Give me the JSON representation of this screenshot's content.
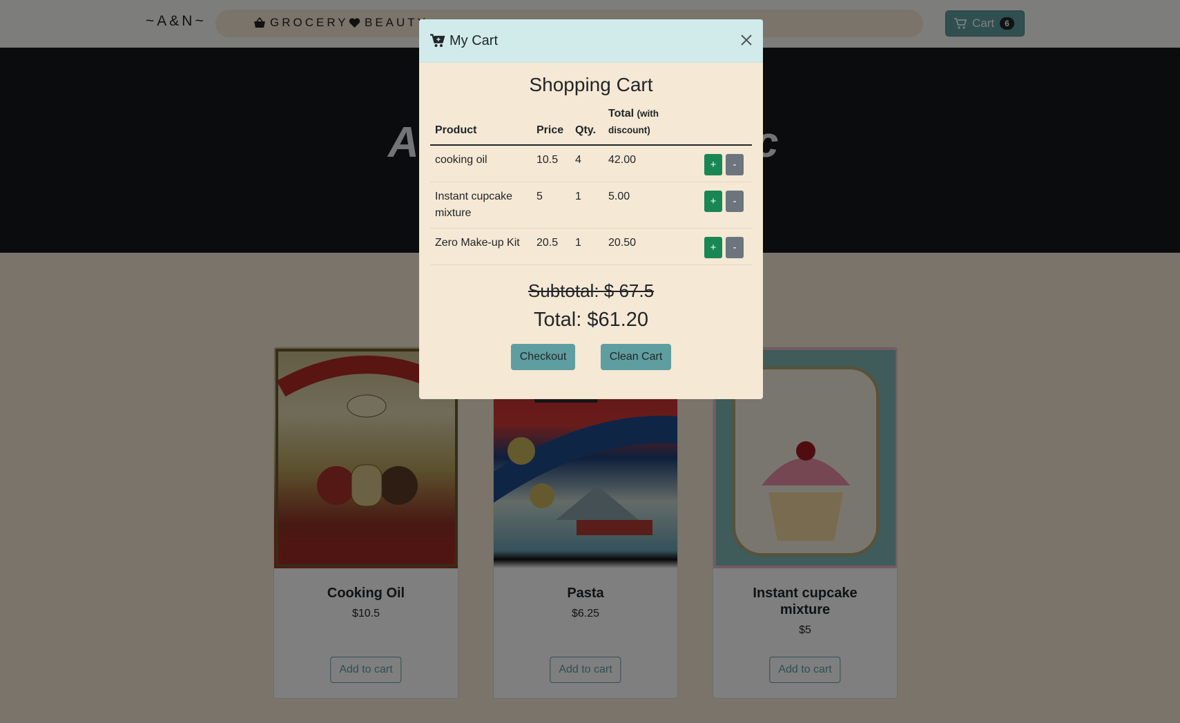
{
  "navbar": {
    "brand": "~A&N~",
    "links": [
      {
        "label": "GROCERY",
        "icon": "basket-icon"
      },
      {
        "label": "BEAUTY",
        "icon": "heart-icon"
      }
    ],
    "cart": {
      "label": "Cart",
      "count": "6",
      "icon": "cart-icon"
    }
  },
  "hero": {
    "title_visible_fragments": "A c"
  },
  "products": [
    {
      "name": "Cooking Oil",
      "price": "$10.5",
      "button": "Add to cart"
    },
    {
      "name": "Pasta",
      "price": "$6.25",
      "button": "Add to cart"
    },
    {
      "name": "Instant cupcake mixture",
      "price": "$5",
      "button": "Add to cart"
    }
  ],
  "modal": {
    "title": "My Cart",
    "heading": "Shopping Cart",
    "columns": {
      "product": "Product",
      "price": "Price",
      "qty": "Qty.",
      "total": "Total",
      "total_note": "(with discount)"
    },
    "items": [
      {
        "product": "cooking oil",
        "price": "10.5",
        "qty": "4",
        "total": "42.00",
        "plus": "+",
        "minus": "-"
      },
      {
        "product": "Instant cupcake mixture",
        "price": "5",
        "qty": "1",
        "total": "5.00",
        "plus": "+",
        "minus": "-"
      },
      {
        "product": "Zero Make-up Kit",
        "price": "20.5",
        "qty": "1",
        "total": "20.50",
        "plus": "+",
        "minus": "-"
      }
    ],
    "subtotal": "Subtotal: $ 67.5",
    "total": "Total: $61.20",
    "checkout": "Checkout",
    "clean": "Clean Cart"
  },
  "colors": {
    "accent": "#5e9ea0",
    "plus": "#198754",
    "minus": "#6c757d",
    "modal_header": "#d0ebea",
    "background": "#f5e8d4"
  }
}
